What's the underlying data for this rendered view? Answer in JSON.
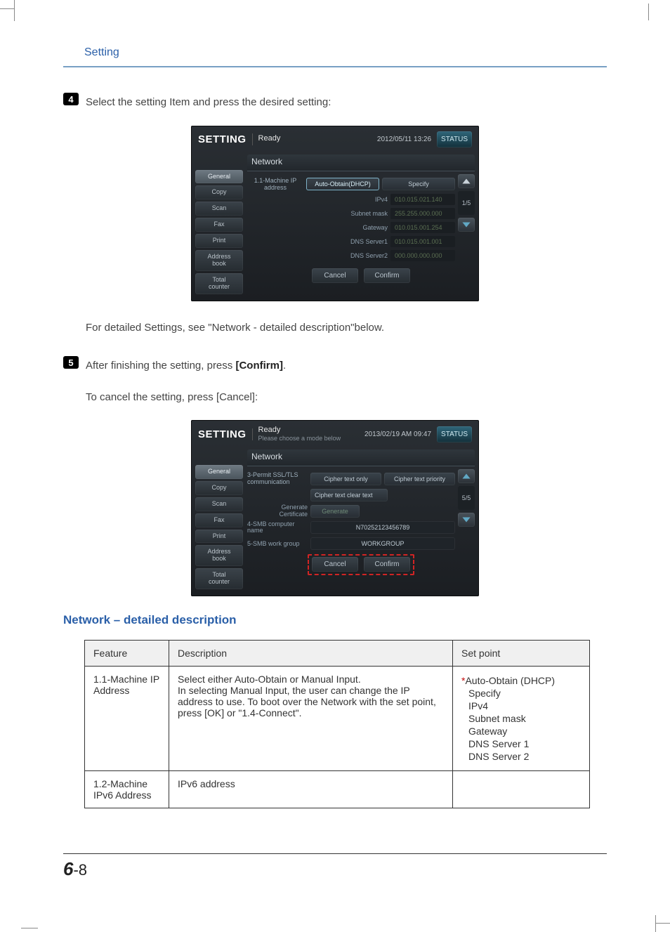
{
  "page": {
    "section_title": "Setting",
    "step4_num": "4",
    "step4_text": "Select the setting Item and press the desired setting:",
    "detail_ref_pre": "For detailed Settings, see ",
    "detail_ref_quote": "\"Network - detailed description\"",
    "detail_ref_post": "below.",
    "step5_num": "5",
    "step5_text_pre": "After finishing the setting, press ",
    "step5_confirm": "[Confirm]",
    "step5_dot": ".",
    "step5_cancel_pre": "To cancel the setting, press ",
    "step5_cancel": "[Cancel]",
    "step5_cancel_post": ":",
    "subheading": "Network – detailed description",
    "page_number_big": "6",
    "page_number_small": "-8"
  },
  "panel1": {
    "title": "SETTING",
    "ready": "Ready",
    "timestamp": "2012/05/11 13:26",
    "status": "STATUS",
    "section": "Network",
    "tabs": [
      "General",
      "Copy",
      "Scan",
      "Fax",
      "Print",
      "Address\nbook",
      "Total\ncounter"
    ],
    "item_label": "1.1-Machine IP\naddress",
    "opt_auto": "Auto-Obtain(DHCP)",
    "opt_specify": "Specify",
    "rows": [
      {
        "k": "IPv4",
        "v": "010.015.021.140"
      },
      {
        "k": "Subnet mask",
        "v": "255.255.000.000"
      },
      {
        "k": "Gateway",
        "v": "010.015.001.254"
      },
      {
        "k": "DNS Server1",
        "v": "010.015.001.001"
      },
      {
        "k": "DNS Server2",
        "v": "000.000.000.000"
      }
    ],
    "page": "1/5",
    "cancel": "Cancel",
    "confirm": "Confirm"
  },
  "panel2": {
    "title": "SETTING",
    "ready": "Ready",
    "sub": "Please choose a mode below",
    "timestamp": "2013/02/19 AM 09:47",
    "status": "STATUS",
    "section": "Network",
    "tabs": [
      "General",
      "Copy",
      "Scan",
      "Fax",
      "Print",
      "Address\nbook",
      "Total\ncounter"
    ],
    "r1_label": "3-Permit SSL/TLS\ncommunication",
    "r1_prefix": "3-",
    "r1_opt1": "Cipher text only",
    "r1_opt2": "Cipher text priority",
    "r1_opt3": "Cipher text clear text",
    "r2_label": "Generate\nCertificate",
    "r2_btn": "Generate",
    "r3_label": "4-SMB computer\nname",
    "r3_val": "N70252123456789",
    "r4_label": "5-SMB work group",
    "r4_val": "WORKGROUP",
    "page": "5/5",
    "cancel": "Cancel",
    "confirm": "Confirm"
  },
  "table": {
    "h_feature": "Feature",
    "h_desc": "Description",
    "h_set": "Set point",
    "row1": {
      "feature": "1.1-Machine IP Address",
      "desc_l1": "Select either Auto-Obtain or Manual Input.",
      "desc_l2": "In selecting Manual Input, the user can change the IP address to use. To boot over the Network with the set point, press ",
      "desc_bold1": "[OK]",
      "desc_or": " or ",
      "desc_bold2": "\"1.4-Connect\"",
      "desc_end": ".",
      "set": [
        "*Auto-Obtain (DHCP)",
        "Specify",
        "IPv4",
        "Subnet mask",
        "Gateway",
        "DNS Server 1",
        "DNS Server 2"
      ]
    },
    "row2": {
      "feature": "1.2-Machine IPv6 Address",
      "desc": "IPv6 address",
      "set": ""
    }
  }
}
